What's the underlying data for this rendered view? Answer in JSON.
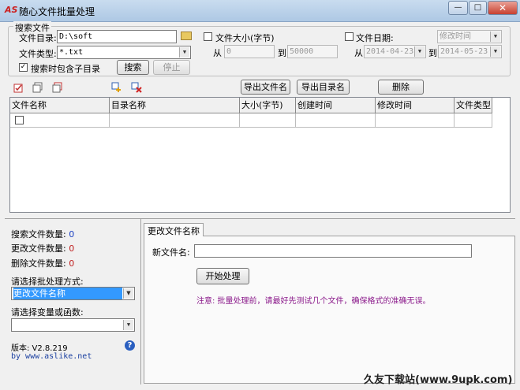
{
  "window": {
    "title": "随心文件批量处理",
    "icon_text": "AS",
    "min_label": "—",
    "max_label": "□",
    "close_label": "✕"
  },
  "search_group": {
    "legend": "搜索文件",
    "dir_label": "文件目录:",
    "dir_value": "D:\\soft",
    "type_label": "文件类型:",
    "type_value": "*.txt",
    "include_sub_label": "搜索时包含子目录",
    "include_sub_checked": true,
    "search_button": "搜索",
    "stop_button": "停止",
    "size_check_label": "文件大小(字节)",
    "size_from_label": "从",
    "size_from_value": "0",
    "size_to_label": "到",
    "size_to_value": "50000",
    "date_check_label": "文件日期:",
    "date_type_value": "修改时间",
    "date_from_label": "从",
    "date_from_value": "2014-04-23",
    "date_to_label": "到",
    "date_to_value": "2014-05-23"
  },
  "toolbar": {
    "export_file_names": "导出文件名",
    "export_dir_names": "导出目录名",
    "delete": "删除",
    "icons": [
      "check-all-icon",
      "uncheck-all-icon",
      "invert-selection-icon",
      "add-item-icon",
      "remove-item-icon"
    ]
  },
  "table": {
    "columns": [
      "文件名称",
      "目录名称",
      "大小(字节)",
      "创建时间",
      "修改时间",
      "文件类型"
    ]
  },
  "stats": {
    "search_count_label": "搜索文件数量:",
    "search_count": "0",
    "change_count_label": "更改文件数量:",
    "change_count": "0",
    "delete_count_label": "删除文件数量:",
    "delete_count": "0"
  },
  "process": {
    "mode_label": "请选择批处理方式:",
    "mode_value": "更改文件名称",
    "var_label": "请选择变量或函数:",
    "var_value": ""
  },
  "about": {
    "version_label": "版本: V2.8.219",
    "website": "by www.aslike.net"
  },
  "tab": {
    "label": "更改文件名称",
    "new_name_label": "新文件名:",
    "new_name_value": "",
    "start_button": "开始处理",
    "notice": "注意: 批量处理前，请最好先测试几个文件，确保格式的准确无误。"
  },
  "watermark": "久友下载站(www.9upk.com)",
  "colors": {
    "selected_blue": "#3399ff",
    "notice_purple": "#8b1a8b"
  }
}
